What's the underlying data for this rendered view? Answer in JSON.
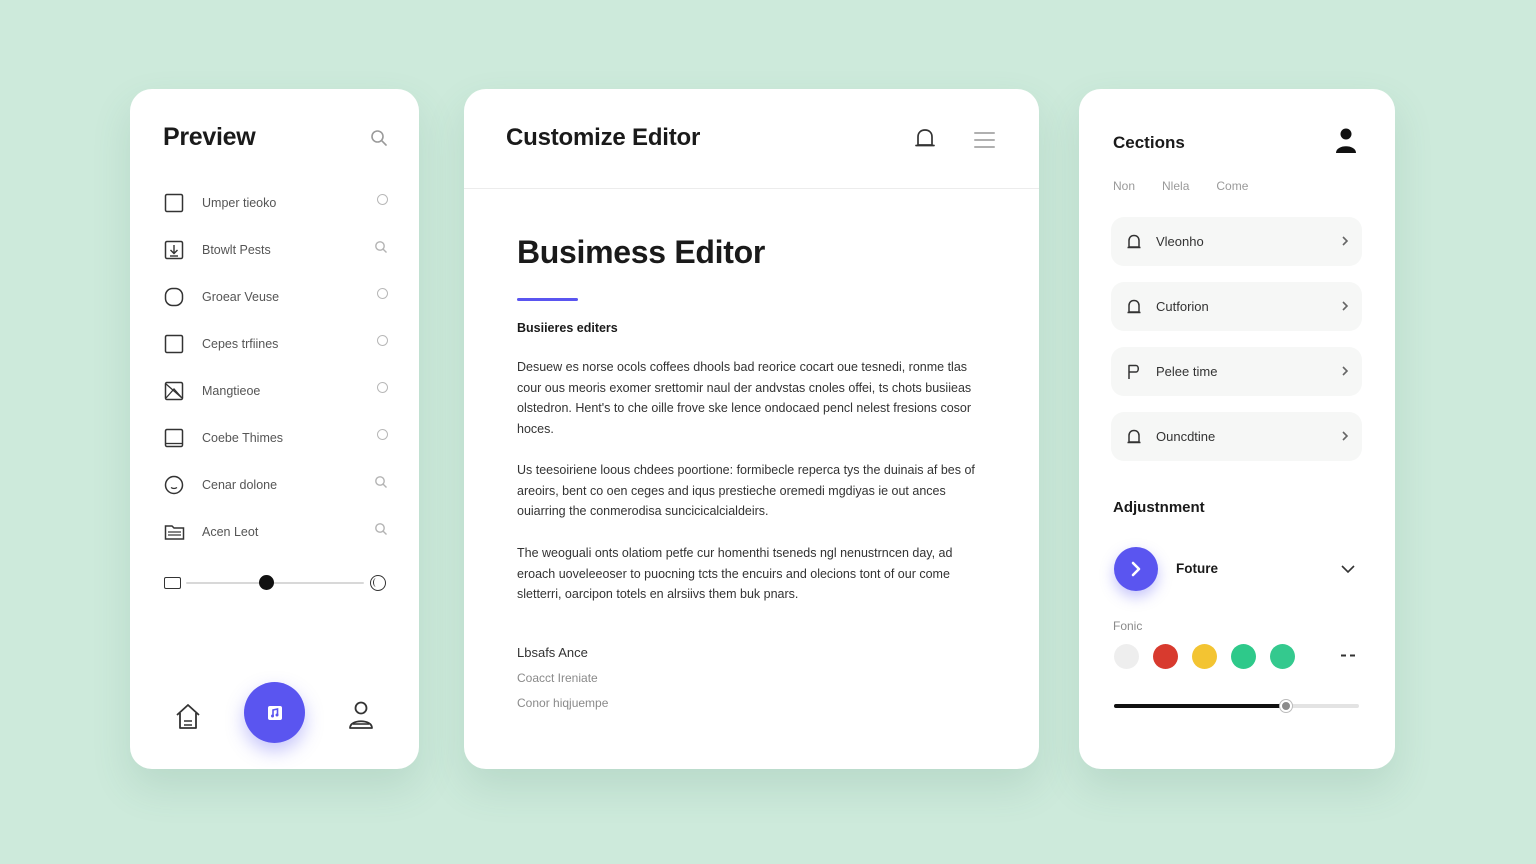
{
  "colors": {
    "background": "#cdeadb",
    "accent": "#5a55f0",
    "card": "#ffffff"
  },
  "preview": {
    "title": "Preview",
    "search_icon": "search-icon",
    "items": [
      {
        "label": "Umper tieoko",
        "icon": "square-icon",
        "trail": "circle"
      },
      {
        "label": "Btowlt Pests",
        "icon": "download-box-icon",
        "trail": "search"
      },
      {
        "label": "Groear Veuse",
        "icon": "rounded-square-icon",
        "trail": "circle"
      },
      {
        "label": "Cepes trfiines",
        "icon": "square-icon",
        "trail": "circle"
      },
      {
        "label": "Mangtieoe",
        "icon": "image-icon",
        "trail": "circle"
      },
      {
        "label": "Coebe Thimes",
        "icon": "frame-icon",
        "trail": "circle"
      },
      {
        "label": "Cenar dolone",
        "icon": "smiley-icon",
        "trail": "search"
      },
      {
        "label": "Acen Leot",
        "icon": "folder-icon",
        "trail": "search"
      }
    ],
    "slider_value": 0.45,
    "nav": {
      "home_icon": "home-icon",
      "fab_icon": "music-note-icon",
      "user_icon": "user-icon"
    }
  },
  "editor": {
    "title": "Customize Editor",
    "bell_icon": "bell-icon",
    "menu_icon": "menu-icon",
    "heading": "Busimess Editor",
    "subheading": "Busiieres editers",
    "paragraphs": [
      "Desuew es norse ocols coffees dhools bad reorice cocart oue tesnedi, ronme tlas cour ous meoris exomer srettomir naul der andvstas cnoles offei, ts chots busiieas olstedron. Hent's to che oille frove ske lence ondocaed pencl nelest fresions cosor hoces.",
      "Us teesoiriene loous chdees poortione: formibecle reperca tys the duinais af bes of areoirs, bent co oen ceges and iqus prestieche oremedi mgdiyas ie out ances ouiarring the conmerodisa suncicicalcialdeirs.",
      "The weoguali onts olatiom petfe cur homenthi tseneds ngl nenustrncen day, ad eroach uoveleeoser to puocning tcts the encuirs and olecions tont of our come sletterri, oarcipon totels en alrsiivs them buk pnars."
    ],
    "footer": [
      "Lbsafs Ance",
      "Coacct Ireniate",
      "Conor hiqjuempe"
    ]
  },
  "sections": {
    "title": "Cections",
    "user_icon": "user-icon",
    "tabs": [
      "Non",
      "Nlela",
      "Come"
    ],
    "items": [
      {
        "label": "Vleonho",
        "icon": "bell-icon"
      },
      {
        "label": "Cutforion",
        "icon": "bell-icon"
      },
      {
        "label": "Pelee time",
        "icon": "flag-icon"
      },
      {
        "label": "Ouncdtine",
        "icon": "bell-icon"
      }
    ],
    "adjustment_title": "Adjustnment",
    "adjust_button_icon": "chevron-right-icon",
    "adjust_label": "Foture",
    "color_label": "Fonic",
    "swatches": [
      "#eeeeee",
      "#d83a2e",
      "#f3c432",
      "#2ec98a",
      "#34c98e"
    ],
    "slider_value": 0.7
  }
}
